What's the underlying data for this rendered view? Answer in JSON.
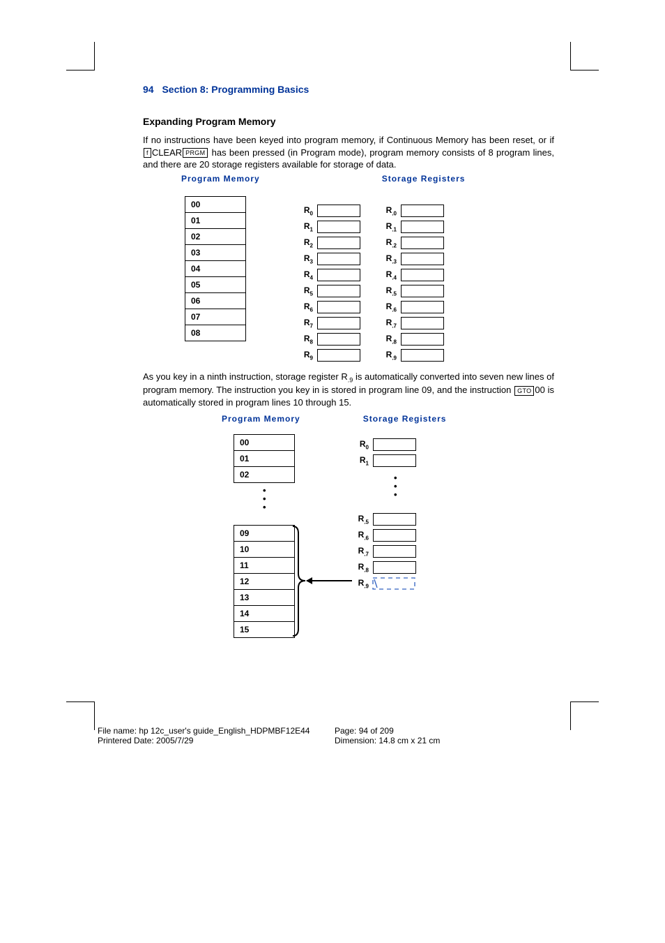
{
  "header": {
    "page_number": "94",
    "section": "Section 8: Programming Basics"
  },
  "subheading": "Expanding Program Memory",
  "para1": {
    "t1": "If no instructions have been keyed into program memory, if Continuous Memory has been reset, or if ",
    "key_f": "f",
    "t2": "CLEAR",
    "key_prgm": "PRGM",
    "t3": " has been pressed (in Program mode), program memory consists of 8 program lines, and there are 20 storage registers available for storage of data."
  },
  "diag_labels": {
    "program_memory": "Program Memory",
    "storage_registers": "Storage Registers"
  },
  "diag1": {
    "pm_lines": [
      "00",
      "01",
      "02",
      "03",
      "04",
      "05",
      "06",
      "07",
      "08"
    ],
    "regs_left": [
      "0",
      "1",
      "2",
      "3",
      "4",
      "5",
      "6",
      "7",
      "8",
      "9"
    ],
    "regs_right": [
      ".0",
      ".1",
      ".2",
      ".3",
      ".4",
      ".5",
      ".6",
      ".7",
      ".8",
      ".9"
    ]
  },
  "para2": {
    "t1": "As you key in a ninth instruction, storage register R",
    "sub1": ".9",
    "t2": " is automatically converted into seven new lines of program memory. The instruction you key in is stored in program line 09, and the instruction ",
    "key_gto": "GTO",
    "t3": "00 is automatically stored in program lines 10 through 15."
  },
  "diag2": {
    "pm_top": [
      "00",
      "01",
      "02"
    ],
    "pm_bottom": [
      "09",
      "10",
      "11",
      "12",
      "13",
      "14",
      "15"
    ],
    "regs_top": [
      "0",
      "1"
    ],
    "regs_bottom": [
      ".5",
      ".6",
      ".7",
      ".8",
      ".9"
    ]
  },
  "reg_prefix": "R",
  "footer": {
    "filename_label": "File name: ",
    "filename": "hp 12c_user's guide_English_HDPMBF12E44",
    "printed_label": "Printered Date: ",
    "printed": "2005/7/29",
    "page_label": "Page: ",
    "page": "94 of 209",
    "dim_label": "Dimension: ",
    "dim": "14.8 cm x 21 cm"
  }
}
